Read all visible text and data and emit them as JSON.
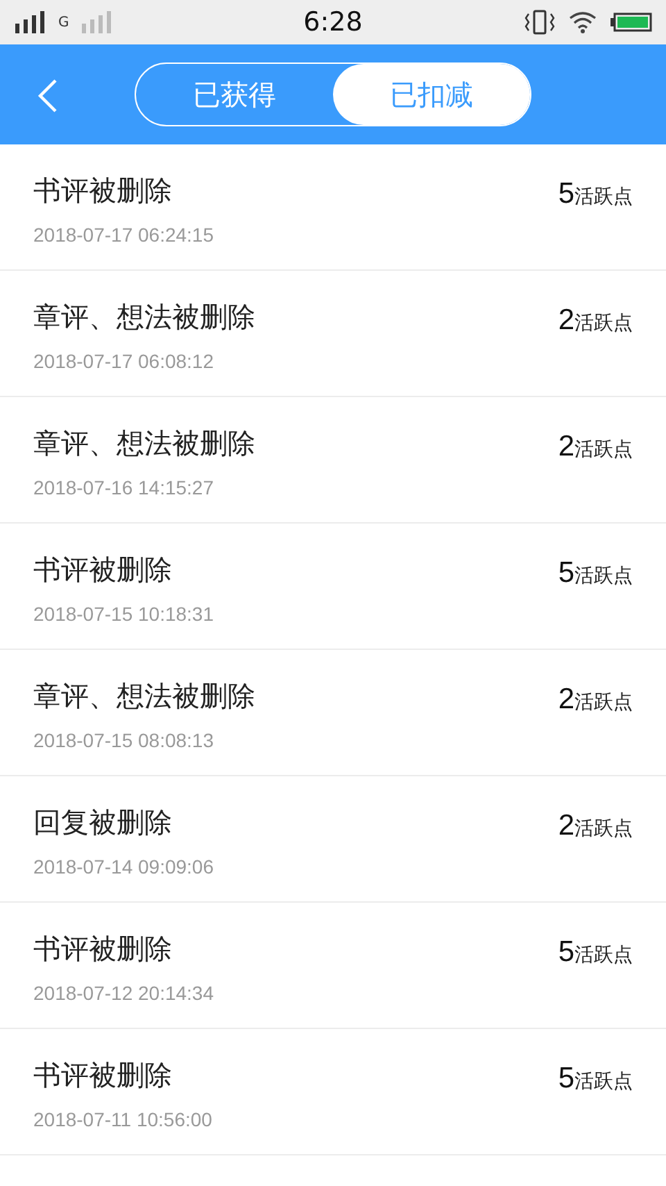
{
  "status_bar": {
    "network": "G",
    "time": "6:28"
  },
  "header": {
    "tabs": [
      {
        "label": "已获得",
        "selected": false
      },
      {
        "label": "已扣减",
        "selected": true
      }
    ]
  },
  "records": [
    {
      "title": "书评被删除",
      "time": "2018-07-17 06:24:15",
      "points": "5",
      "unit": "活跃点"
    },
    {
      "title": "章评、想法被删除",
      "time": "2018-07-17 06:08:12",
      "points": "2",
      "unit": "活跃点"
    },
    {
      "title": "章评、想法被删除",
      "time": "2018-07-16 14:15:27",
      "points": "2",
      "unit": "活跃点"
    },
    {
      "title": "书评被删除",
      "time": "2018-07-15 10:18:31",
      "points": "5",
      "unit": "活跃点"
    },
    {
      "title": "章评、想法被删除",
      "time": "2018-07-15 08:08:13",
      "points": "2",
      "unit": "活跃点"
    },
    {
      "title": "回复被删除",
      "time": "2018-07-14 09:09:06",
      "points": "2",
      "unit": "活跃点"
    },
    {
      "title": "书评被删除",
      "time": "2018-07-12 20:14:34",
      "points": "5",
      "unit": "活跃点"
    },
    {
      "title": "书评被删除",
      "time": "2018-07-11 10:56:00",
      "points": "5",
      "unit": "活跃点"
    }
  ]
}
